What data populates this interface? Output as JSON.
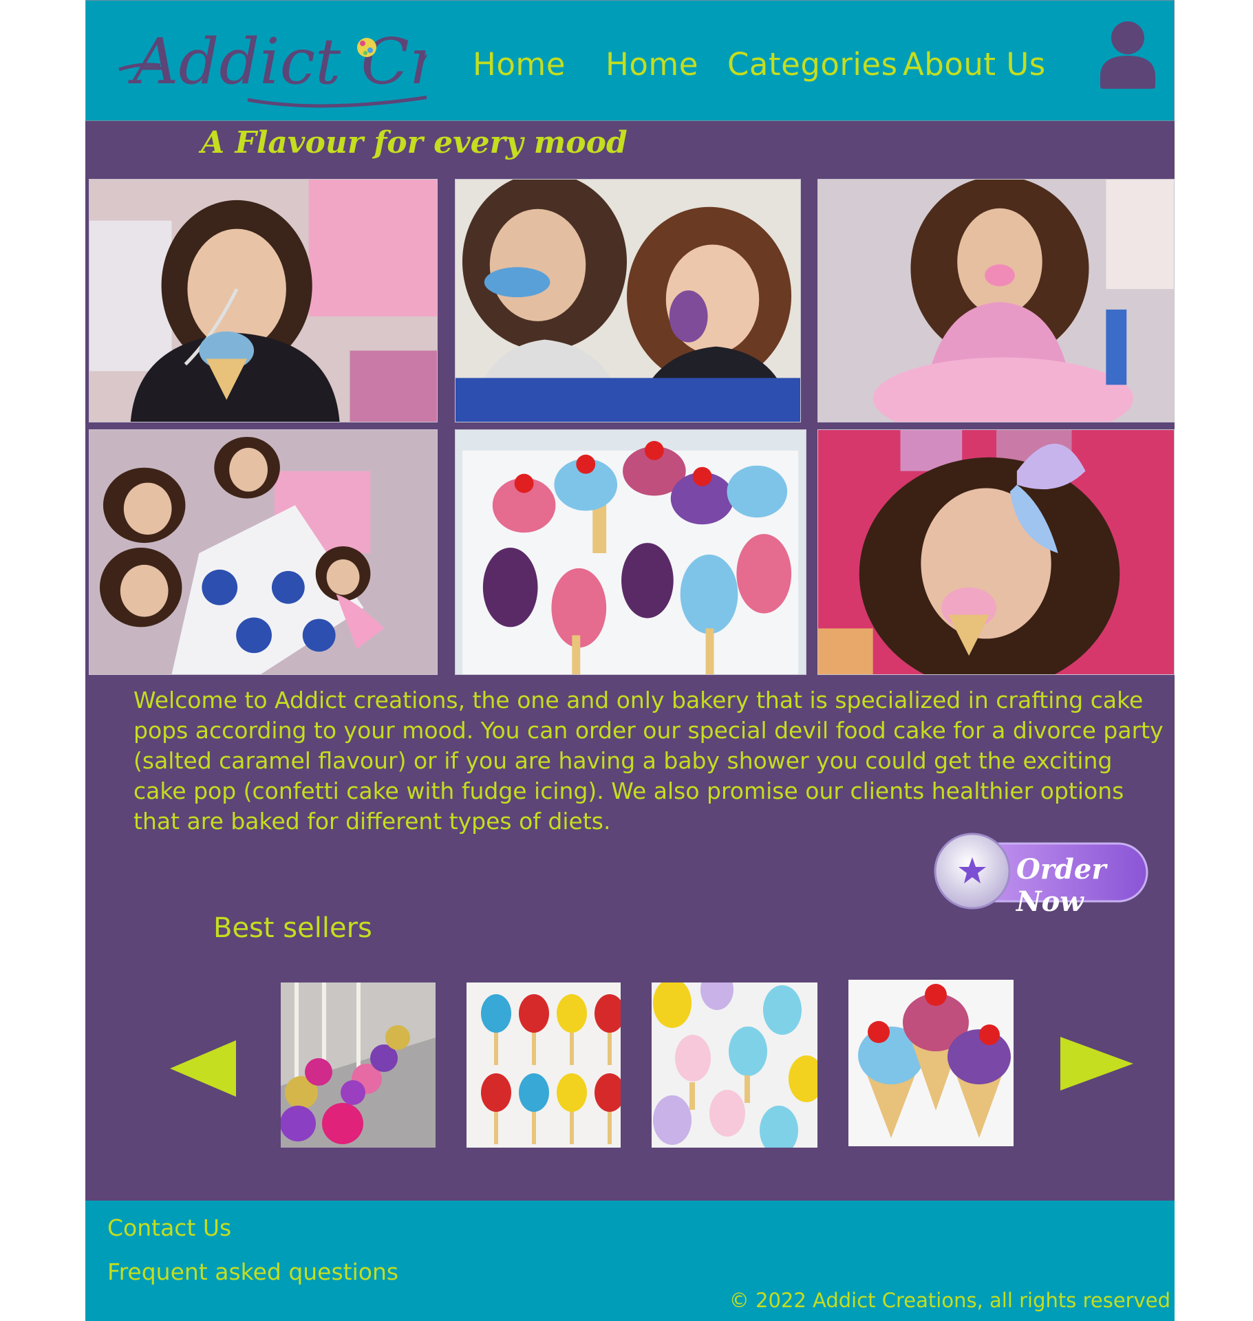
{
  "header": {
    "logo_text": "Addict Creations",
    "nav": [
      "Home",
      "Home",
      "Categories",
      "About Us"
    ],
    "user_icon": "user-icon"
  },
  "hero": {
    "tagline": "A Flavour for every mood",
    "photos": [
      "girl-with-cone-cake-pop",
      "two-girls-eating-cake-pops",
      "girl-in-pink-tutu",
      "kids-at-party-table",
      "cake-pop-assortment",
      "girl-with-bow-eating-cone"
    ]
  },
  "welcome": {
    "text": "Welcome to Addict creations, the one and only bakery that is specialized in crafting cake pops according to your mood. You can order our special devil food cake for a divorce party (salted caramel flavour) or if you are having a baby shower you could get the exciting cake pop (confetti cake with fudge icing). We also promise our clients healthier options that are baked for different types of diets."
  },
  "order_button": {
    "label": "Order Now",
    "icon": "star-icon"
  },
  "best_sellers": {
    "title": "Best sellers",
    "prev_icon": "left-arrow-icon",
    "next_icon": "right-arrow-icon",
    "items": [
      "glitter-cake-pops",
      "superhero-cake-pops",
      "sprinkle-popsicle-cake-pops",
      "ice-cream-cone-cake-pops"
    ]
  },
  "footer": {
    "links": [
      "Contact Us",
      "Frequent asked questions"
    ],
    "copyright": "© 2022 Addict Creations, all rights reserved"
  },
  "colors": {
    "header_bg": "#009db8",
    "main_bg": "#5d4577",
    "accent": "#c5de1f",
    "logo": "#5d4577",
    "button_purple": "#a66ee8"
  }
}
